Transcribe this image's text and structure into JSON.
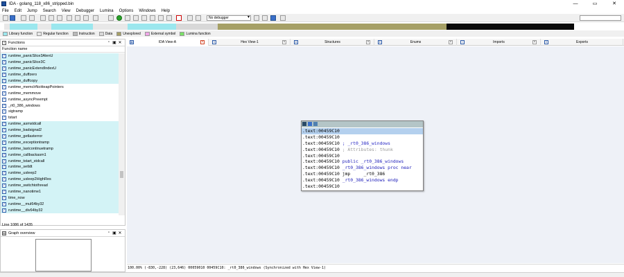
{
  "window": {
    "title": "IDA - golang_118_x86_stripped.bin",
    "controls": [
      "—",
      "▭",
      "✕"
    ]
  },
  "menu": [
    "File",
    "Edit",
    "Jump",
    "Search",
    "View",
    "Debugger",
    "Lumina",
    "Options",
    "Windows",
    "Help"
  ],
  "toolbar": {
    "debugger_select": "No debugger"
  },
  "legend": [
    {
      "label": "Library function",
      "color": "#9be7ee"
    },
    {
      "label": "Regular function",
      "color": "#e8e8e8"
    },
    {
      "label": "Instruction",
      "color": "#b9b9b9"
    },
    {
      "label": "Data",
      "color": "#d8d8d8"
    },
    {
      "label": "Unexplored",
      "color": "#a6a066"
    },
    {
      "label": "External symbol",
      "color": "#f1a6e8"
    },
    {
      "label": "Lumina function",
      "color": "#79e067"
    }
  ],
  "functions_panel": {
    "title": "Functions",
    "column_header": "Function name",
    "items": [
      {
        "name": "runtime_panicSlice3AlenU",
        "lib": true
      },
      {
        "name": "runtime_panicSlice3C",
        "lib": true
      },
      {
        "name": "runtime_panicExtendIndexU",
        "lib": true
      },
      {
        "name": "runtime_duffzero",
        "lib": true
      },
      {
        "name": "runtime_duffcopy",
        "lib": true
      },
      {
        "name": "runtime_memclrNoHeapPointers",
        "lib": false
      },
      {
        "name": "runtime_memmove",
        "lib": false
      },
      {
        "name": "runtime_asyncPreempt",
        "lib": false
      },
      {
        "name": "_rt0_386_windows",
        "lib": false
      },
      {
        "name": "sigtramp",
        "lib": false
      },
      {
        "name": "tstart",
        "lib": false
      },
      {
        "name": "runtime_asmstdcall",
        "lib": true
      },
      {
        "name": "runtime_badsignal2",
        "lib": true
      },
      {
        "name": "runtime_getlasterror",
        "lib": true
      },
      {
        "name": "runtime_exceptiontramp",
        "lib": true
      },
      {
        "name": "runtime_lastcontinuetramp",
        "lib": true
      },
      {
        "name": "runtime_callbackasm1",
        "lib": true
      },
      {
        "name": "runtime_tstart_stdcall",
        "lib": true
      },
      {
        "name": "runtime_setldt",
        "lib": true
      },
      {
        "name": "runtime_usleep2",
        "lib": true
      },
      {
        "name": "runtime_usleep2HighRes",
        "lib": true
      },
      {
        "name": "runtime_switchtothread",
        "lib": true
      },
      {
        "name": "runtime_nanotime1",
        "lib": true
      },
      {
        "name": "time_now",
        "lib": true
      },
      {
        "name": "runtime__mul64by32",
        "lib": true
      },
      {
        "name": "runtime__div64by32",
        "lib": true
      }
    ],
    "status": "Line 1086 of 1435",
    "scroll_position": 0.76
  },
  "graph_overview": {
    "title": "Graph overview"
  },
  "tabs": [
    {
      "label": "IDA View-A",
      "active": true,
      "closable": true
    },
    {
      "label": "Hex View-1",
      "active": false,
      "closable": true
    },
    {
      "label": "Structures",
      "active": false,
      "closable": true
    },
    {
      "label": "Enums",
      "active": false,
      "closable": true
    },
    {
      "label": "Imports",
      "active": false,
      "closable": true
    },
    {
      "label": "Exports",
      "active": false,
      "closable": true
    }
  ],
  "code_node": {
    "lines": [
      {
        "addr": ".text:00459C10",
        "text": ""
      },
      {
        "addr": ".text:00459C10",
        "text": ""
      },
      {
        "addr": ".text:00459C10",
        "text": " ; _rt0_386_windows"
      },
      {
        "addr": ".text:00459C10",
        "text": " ; Attributes: thunk"
      },
      {
        "addr": ".text:00459C10",
        "text": ""
      },
      {
        "addr": ".text:00459C10",
        "text": " public _rt0_386_windows"
      },
      {
        "addr": ".text:00459C10",
        "text": " _rt0_386_windows proc near"
      },
      {
        "addr": ".text:00459C10",
        "text": " jmp     _rt0_386"
      },
      {
        "addr": ".text:00459C10",
        "text": " _rt0_386_windows endp"
      },
      {
        "addr": ".text:00459C10",
        "text": ""
      }
    ]
  },
  "ida_status": "100.00% (-830,-228) (23,646) 00059010 00459C10: _rt0_386_windows (Synchronized with Hex View-1)"
}
